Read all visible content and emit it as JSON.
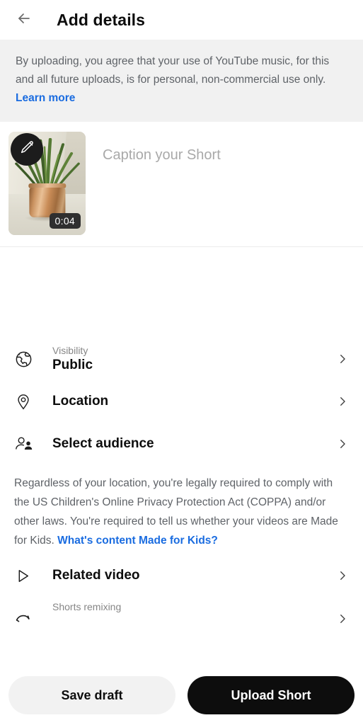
{
  "header": {
    "back_icon": "arrow-left-icon",
    "title": "Add details"
  },
  "notice": {
    "text": "By uploading, you agree that your use of YouTube music, for this and all future uploads, is for personal, non-commercial use only.",
    "link_label": "Learn more",
    "background": "#f1f1f1"
  },
  "caption": {
    "placeholder": "Caption your Short",
    "thumbnail": {
      "duration": "0:04",
      "edit_icon": "pencil-icon",
      "description": "potted green grass plant in copper pot"
    }
  },
  "settings": {
    "visibility": {
      "icon": "globe-icon",
      "label": "Visibility",
      "value": "Public",
      "chevron": "chevron-right-icon"
    },
    "location": {
      "icon": "location-pin-icon",
      "label": "Location",
      "chevron": "chevron-right-icon"
    },
    "audience": {
      "icon": "people-icon",
      "label": "Select audience",
      "chevron": "chevron-right-icon"
    },
    "related_video": {
      "icon": "play-triangle-icon",
      "label": "Related video",
      "chevron": "chevron-right-icon"
    },
    "shorts_remixing": {
      "icon": "remix-loop-icon",
      "label": "Shorts remixing",
      "chevron": "chevron-right-icon"
    }
  },
  "coppa": {
    "text": "Regardless of your location, you're legally required to comply with the US Children's Online Privacy Protection Act (COPPA) and/or other laws. You're required to tell us whether your videos are Made for Kids.",
    "link_label": "What's content Made for Kids?"
  },
  "actions": {
    "save_draft": "Save draft",
    "upload": "Upload Short"
  },
  "colors": {
    "link": "#1a6ce0",
    "primary_button": "#0d0d0d",
    "secondary_button": "#f2f2f2",
    "banner": "#f1f1f1"
  }
}
